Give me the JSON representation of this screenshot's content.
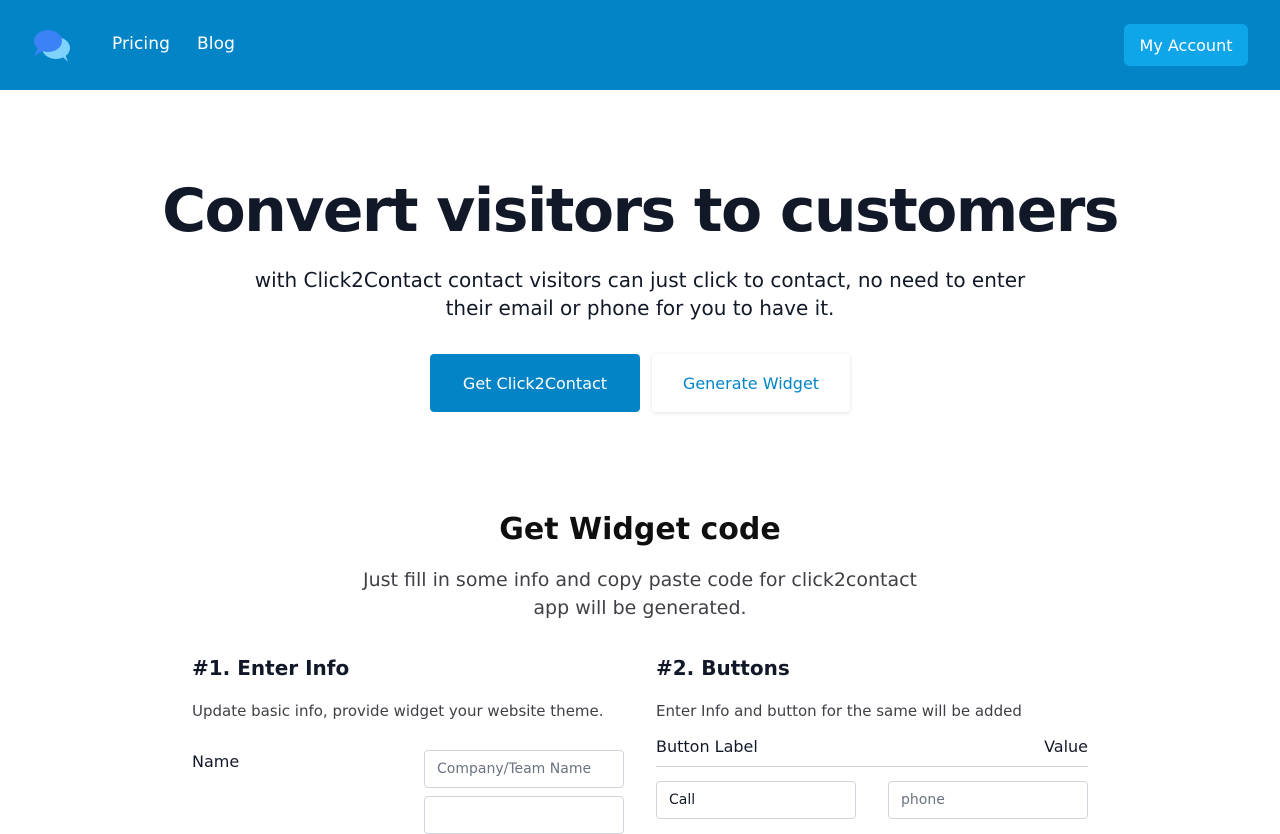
{
  "header": {
    "logo_icon": "chat-bubbles-icon",
    "nav": [
      {
        "label": "Pricing"
      },
      {
        "label": "Blog"
      }
    ],
    "account_label": "My Account",
    "colors": {
      "bar": "#0284c7",
      "account": "#0ea5e9"
    }
  },
  "hero": {
    "title": "Convert visitors to customers",
    "subtitle": "with Click2Contact contact visitors can just click to contact, no need to enter their email or phone for you to have it.",
    "primary_cta": "Get Click2Contact",
    "secondary_cta": "Generate Widget"
  },
  "widget": {
    "title": "Get Widget code",
    "subtitle": "Just fill in some info and copy paste code for click2contact app will be generated.",
    "info": {
      "title": "#1. Enter Info",
      "description": "Update basic info, provide widget your website theme.",
      "name_label": "Name",
      "name_placeholder": "Company/Team Name"
    },
    "buttons": {
      "title": "#2. Buttons",
      "description": "Enter Info and button for the same will be added",
      "col_label": "Button Label",
      "col_value": "Value",
      "row_label_value": "Call",
      "row_value_placeholder": "phone"
    }
  }
}
